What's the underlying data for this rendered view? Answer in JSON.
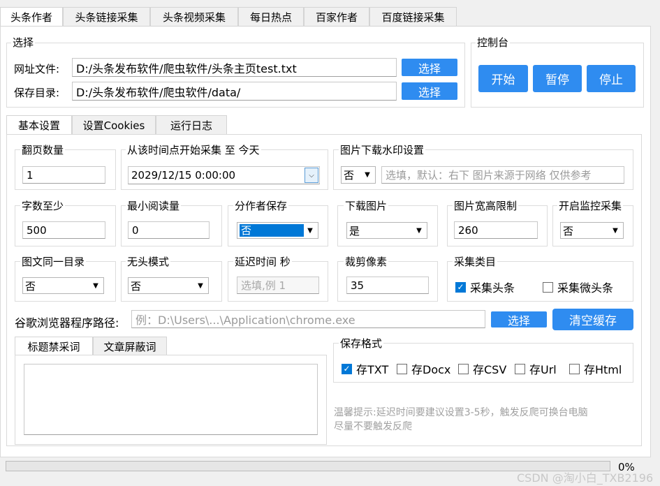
{
  "top_tabs": [
    "头条作者",
    "头条链接采集",
    "头条视频采集",
    "每日热点",
    "百家作者",
    "百度链接采集"
  ],
  "select_group": {
    "title": "选择",
    "url_file_label": "网址文件:",
    "url_file_value": "D:/头条发布软件/爬虫软件/头条主页test.txt",
    "save_dir_label": "保存目录:",
    "save_dir_value": "D:/头条发布软件/爬虫软件/data/",
    "choose_label": "选择"
  },
  "console": {
    "title": "控制台",
    "start": "开始",
    "pause": "暂停",
    "stop": "停止"
  },
  "settings_tabs": [
    "基本设置",
    "设置Cookies",
    "运行日志"
  ],
  "fields": {
    "page_count_title": "翻页数量",
    "page_count_value": "1",
    "time_title": "从该时间点开始采集 至 今天",
    "time_value": "2029/12/15 0:00:00",
    "watermark_title": "图片下载水印设置",
    "watermark_select": "否",
    "watermark_placeholder": "选填，默认：右下 图片来源于网络 仅供参考",
    "min_chars_title": "字数至少",
    "min_chars_value": "500",
    "min_reads_title": "最小阅读量",
    "min_reads_value": "0",
    "per_author_title": "分作者保存",
    "per_author_value": "否",
    "download_images_title": "下载图片",
    "download_images_value": "是",
    "image_size_title": "图片宽高限制",
    "image_size_value": "260",
    "monitor_title": "开启监控采集",
    "monitor_value": "否",
    "same_dir_title": "图文同一目录",
    "same_dir_value": "否",
    "headless_title": "无头模式",
    "headless_value": "否",
    "delay_title": "延迟时间 秒",
    "delay_placeholder": "选填,例 1",
    "crop_title": "裁剪像素",
    "crop_value": "35",
    "category_title": "采集类目",
    "category_toutiao": "采集头条",
    "category_weitoutiao": "采集微头条"
  },
  "chrome": {
    "label": "谷歌浏览器程序路径:",
    "placeholder": "例：D:\\Users\\...\\Application\\chrome.exe",
    "choose": "选择",
    "clear_cache": "清空缓存"
  },
  "word_tabs": [
    "标题禁采词",
    "文章屏蔽词"
  ],
  "save_format": {
    "title": "保存格式",
    "options": [
      "存TXT",
      "存Docx",
      "存CSV",
      "存Url",
      "存Html"
    ],
    "checked": [
      true,
      false,
      false,
      false,
      false
    ]
  },
  "tip": {
    "line1": "温馨提示:延迟时间要建议设置3-5秒，触发反爬可换台电脑",
    "line2": "尽量不要触发反爬"
  },
  "progress": {
    "value": 0,
    "text": "0%"
  },
  "watermark_text": "CSDN @淘小白_TXB2196",
  "colors": {
    "accent": "#2f8cf0",
    "checkbox": "#0078d7"
  }
}
